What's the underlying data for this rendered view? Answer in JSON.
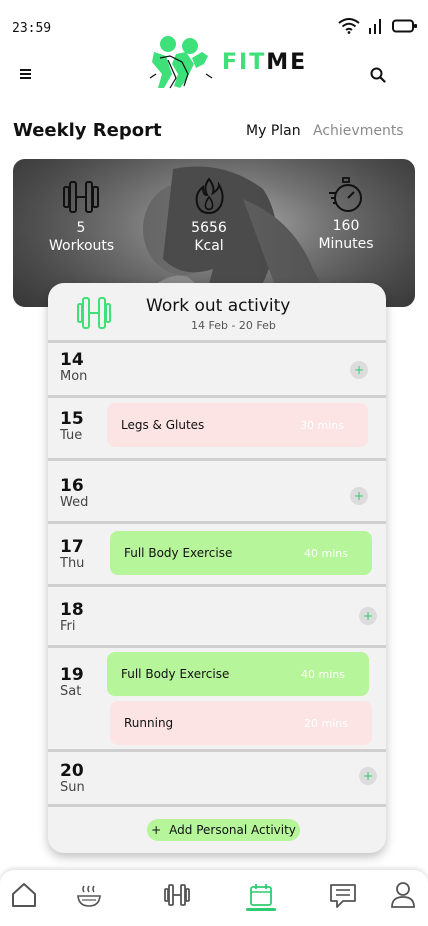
{
  "status_bar": {
    "time": "23:59"
  },
  "header": {
    "brand_fit": "FIT",
    "brand_me": "ME"
  },
  "report": {
    "title": "Weekly Report",
    "tabs": [
      {
        "label": "My Plan",
        "active": true
      },
      {
        "label": "Achievments",
        "active": false
      }
    ],
    "stats": [
      {
        "value": "5",
        "label": "Workouts",
        "icon": "dumbbell-icon"
      },
      {
        "value": "5656",
        "label": "Kcal",
        "icon": "flame-icon"
      },
      {
        "value": "160",
        "label": "Minutes",
        "icon": "stopwatch-icon"
      }
    ]
  },
  "activity": {
    "title": "Work out activity",
    "date_range": "14 Feb - 20 Feb",
    "add_button": "Add Personal Activity",
    "days": [
      {
        "date": "14",
        "weekday": "Mon",
        "entries": []
      },
      {
        "date": "15",
        "weekday": "Tue",
        "entries": [
          {
            "name": "Legs & Glutes",
            "duration": "30 mins",
            "color": "#fde4e4"
          }
        ]
      },
      {
        "date": "16",
        "weekday": "Wed",
        "entries": []
      },
      {
        "date": "17",
        "weekday": "Thu",
        "entries": [
          {
            "name": "Full Body Exercise",
            "duration": "40 mins",
            "color": "#b6f59a"
          }
        ]
      },
      {
        "date": "18",
        "weekday": "Fri",
        "entries": []
      },
      {
        "date": "19",
        "weekday": "Sat",
        "entries": [
          {
            "name": "Full Body Exercise",
            "duration": "40 mins",
            "color": "#b6f59a"
          },
          {
            "name": "Running",
            "duration": "20 mins",
            "color": "#fde4e4"
          }
        ]
      },
      {
        "date": "20",
        "weekday": "Sun",
        "entries": []
      }
    ]
  },
  "bottom_nav": [
    {
      "name": "home-icon",
      "active": false
    },
    {
      "name": "food-bowl-icon",
      "active": false
    },
    {
      "name": "dumbbell-icon",
      "active": false
    },
    {
      "name": "calendar-icon",
      "active": true
    },
    {
      "name": "chat-icon",
      "active": false
    },
    {
      "name": "profile-icon",
      "active": false
    }
  ],
  "colors": {
    "accent": "#2ecc71",
    "brand_green": "#3ee07a",
    "pill_green": "#b6f59a",
    "pill_pink": "#fde4e4"
  }
}
